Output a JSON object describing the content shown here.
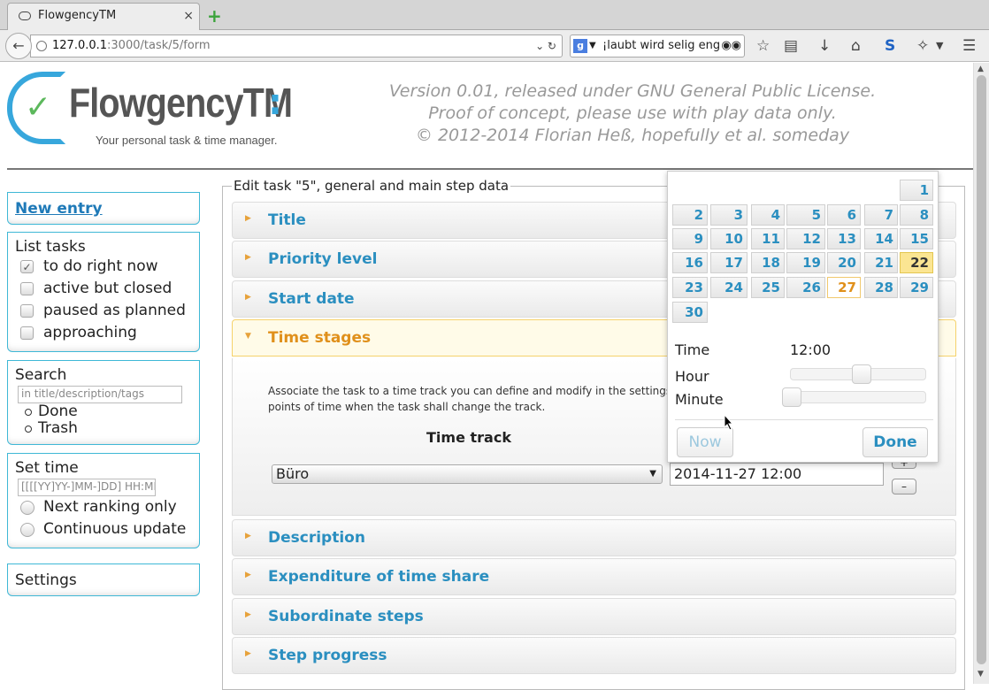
{
  "browser": {
    "tab_title": "FlowgencyTM",
    "tab_close": "×",
    "newtab": "+",
    "url_host": "127.0.0.1",
    "url_rest": ":3000/task/5/form",
    "url_controls": "⌄ ↻",
    "search_engine": "g",
    "search_text": "¡laubt wird selig englisc"
  },
  "header": {
    "logo_name": "FlowgencyTM",
    "logo_tagline": "Your personal task & time manager.",
    "release_lines": [
      "Version 0.01, released under GNU General Public License.",
      "Proof of concept, please use with play data only.",
      "© 2012-2014 Florian Heß, hopefully et al. someday"
    ]
  },
  "sidebar": {
    "new_entry": "New entry",
    "list_tasks": {
      "title": "List tasks",
      "items": [
        {
          "label": "to do right now",
          "checked": true
        },
        {
          "label": "active but closed",
          "checked": false
        },
        {
          "label": "paused as planned",
          "checked": false
        },
        {
          "label": "approaching",
          "checked": false
        }
      ]
    },
    "search": {
      "title": "Search",
      "placeholder": "in title/description/tags",
      "options": [
        "Done",
        "Trash"
      ]
    },
    "set_time": {
      "title": "Set time",
      "placeholder": "[[[[YY]YY-]MM-]DD] HH:MM",
      "options": [
        "Next ranking only",
        "Continuous update"
      ]
    },
    "settings": "Settings"
  },
  "form": {
    "legend": "Edit task \"5\", general and main step data",
    "sections": [
      "Title",
      "Priority level",
      "Start date",
      "Time stages",
      "Description",
      "Expenditure of time share",
      "Subordinate steps",
      "Step progress"
    ],
    "open_section": "Time stages",
    "time_stages": {
      "description": "Associate the task to a time track you can define and modify in the settings, a points of time when the task shall change the track.",
      "time_track_header": "Time track",
      "track_value": "Büro",
      "date_value": "2014-11-27 12:00",
      "plus": "+",
      "minus": "–"
    }
  },
  "datepicker": {
    "days": [
      "1",
      "2",
      "3",
      "4",
      "5",
      "6",
      "7",
      "8",
      "9",
      "10",
      "11",
      "12",
      "13",
      "14",
      "15",
      "16",
      "17",
      "18",
      "19",
      "20",
      "21",
      "22",
      "23",
      "24",
      "25",
      "26",
      "27",
      "28",
      "29",
      "30"
    ],
    "today": "27",
    "selected": "22",
    "time_label": "Time",
    "time_value": "12:00",
    "hour_label": "Hour",
    "minute_label": "Minute",
    "hour_value": 12,
    "minute_value": 0,
    "now_button": "Now",
    "done_button": "Done"
  }
}
